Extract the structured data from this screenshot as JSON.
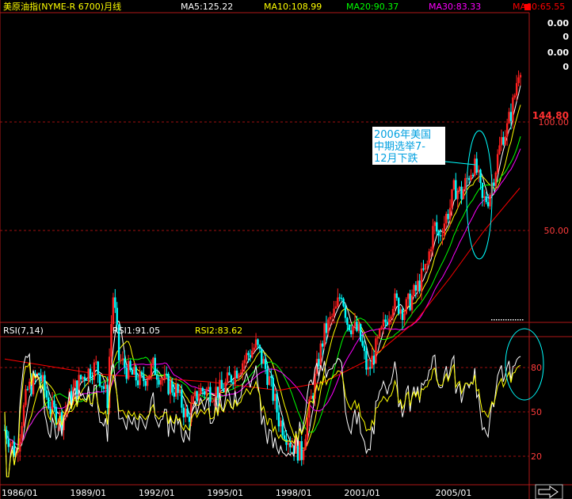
{
  "chart_title": "美原油指(NYME-R 6700)月线",
  "ma_readouts": [
    {
      "label": "MA5:125.22",
      "color": "#ffffff"
    },
    {
      "label": "MA10:108.99",
      "color": "#ffff00"
    },
    {
      "label": "MA20:90.37",
      "color": "#00ff00"
    },
    {
      "label": "MA30:83.33",
      "color": "#ff00ff"
    },
    {
      "label": "MA60:65.55",
      "color": "#ff0000"
    }
  ],
  "price_axis_labels": [
    "0.00",
    "0",
    "0.00",
    "0",
    "100.00",
    "50.00"
  ],
  "last_price_tag": "144.80",
  "annotation": "2006年美国\n中期选举7-\n12月下跌",
  "rsi_panel": {
    "title": "RSI(7,14)",
    "rsi1": "RSI1:91.05",
    "rsi2": "RSI2:83.62",
    "levels": [
      "80",
      "50",
      "20"
    ]
  },
  "colors": {
    "up_candle": "#ff2020",
    "down_candle": "#00ffff",
    "ma5": "#ffffff",
    "ma10": "#ffff00",
    "ma20": "#00ff00",
    "ma30": "#ff00ff",
    "ma60": "#ff0000",
    "grid": "#a01010",
    "annotation": "#00ffff"
  },
  "chart_data": [
    {
      "type": "candlestick",
      "title": "美原油指(NYME-R 6700)月线",
      "x": [
        "1986/01",
        "1989/01",
        "1992/01",
        "1995/01",
        "1998/01",
        "2001/01",
        "2005/01"
      ],
      "y_ticks": [
        50,
        100
      ],
      "series": [
        {
          "name": "MA5",
          "last": 125.22
        },
        {
          "name": "MA10",
          "last": 108.99
        },
        {
          "name": "MA20",
          "last": 90.37
        },
        {
          "name": "MA30",
          "last": 83.33
        },
        {
          "name": "MA60",
          "last": 65.55
        }
      ],
      "closes": [
        [
          1986.0,
          14
        ],
        [
          1986.5,
          12
        ],
        [
          1987.0,
          18
        ],
        [
          1987.5,
          20
        ],
        [
          1988.0,
          16
        ],
        [
          1988.5,
          15
        ],
        [
          1989.0,
          18
        ],
        [
          1989.5,
          20
        ],
        [
          1990.0,
          21
        ],
        [
          1990.5,
          17
        ],
        [
          1990.75,
          33
        ],
        [
          1991.0,
          22
        ],
        [
          1991.5,
          20
        ],
        [
          1992.0,
          19
        ],
        [
          1992.5,
          21
        ],
        [
          1993.0,
          19
        ],
        [
          1993.5,
          18
        ],
        [
          1994.0,
          15
        ],
        [
          1994.5,
          18
        ],
        [
          1995.0,
          18
        ],
        [
          1995.5,
          18
        ],
        [
          1996.0,
          20
        ],
        [
          1996.5,
          22
        ],
        [
          1997.0,
          24
        ],
        [
          1997.5,
          20
        ],
        [
          1998.0,
          15
        ],
        [
          1998.5,
          13
        ],
        [
          1999.0,
          12
        ],
        [
          1999.5,
          18
        ],
        [
          2000.0,
          26
        ],
        [
          2000.5,
          30
        ],
        [
          2000.75,
          34
        ],
        [
          2001.0,
          28
        ],
        [
          2001.5,
          26
        ],
        [
          2001.9,
          20
        ],
        [
          2002.5,
          26
        ],
        [
          2003.0,
          32
        ],
        [
          2003.5,
          30
        ],
        [
          2004.0,
          34
        ],
        [
          2004.5,
          40
        ],
        [
          2004.8,
          52
        ],
        [
          2005.0,
          48
        ],
        [
          2005.5,
          58
        ],
        [
          2005.7,
          66
        ],
        [
          2006.0,
          63
        ],
        [
          2006.5,
          76
        ],
        [
          2006.7,
          72
        ],
        [
          2006.9,
          60
        ],
        [
          2007.2,
          62
        ],
        [
          2007.5,
          75
        ],
        [
          2007.8,
          92
        ],
        [
          2008.0,
          96
        ],
        [
          2008.3,
          115
        ],
        [
          2008.5,
          140
        ],
        [
          2008.55,
          144.8
        ]
      ],
      "ma60_curve": [
        [
          1986.0,
          22
        ],
        [
          1990.0,
          20
        ],
        [
          1995.0,
          19
        ],
        [
          1998.0,
          18
        ],
        [
          2000.0,
          19
        ],
        [
          2002.0,
          22
        ],
        [
          2004.0,
          28
        ],
        [
          2005.5,
          37
        ],
        [
          2007.0,
          50
        ],
        [
          2008.55,
          65.55
        ]
      ]
    },
    {
      "type": "line",
      "title": "RSI(7,14)",
      "ylim": [
        0,
        100
      ],
      "y_ticks": [
        20,
        50,
        80
      ],
      "series": [
        {
          "name": "RSI1",
          "last": 91.05
        },
        {
          "name": "RSI2",
          "last": 83.62
        }
      ]
    }
  ]
}
